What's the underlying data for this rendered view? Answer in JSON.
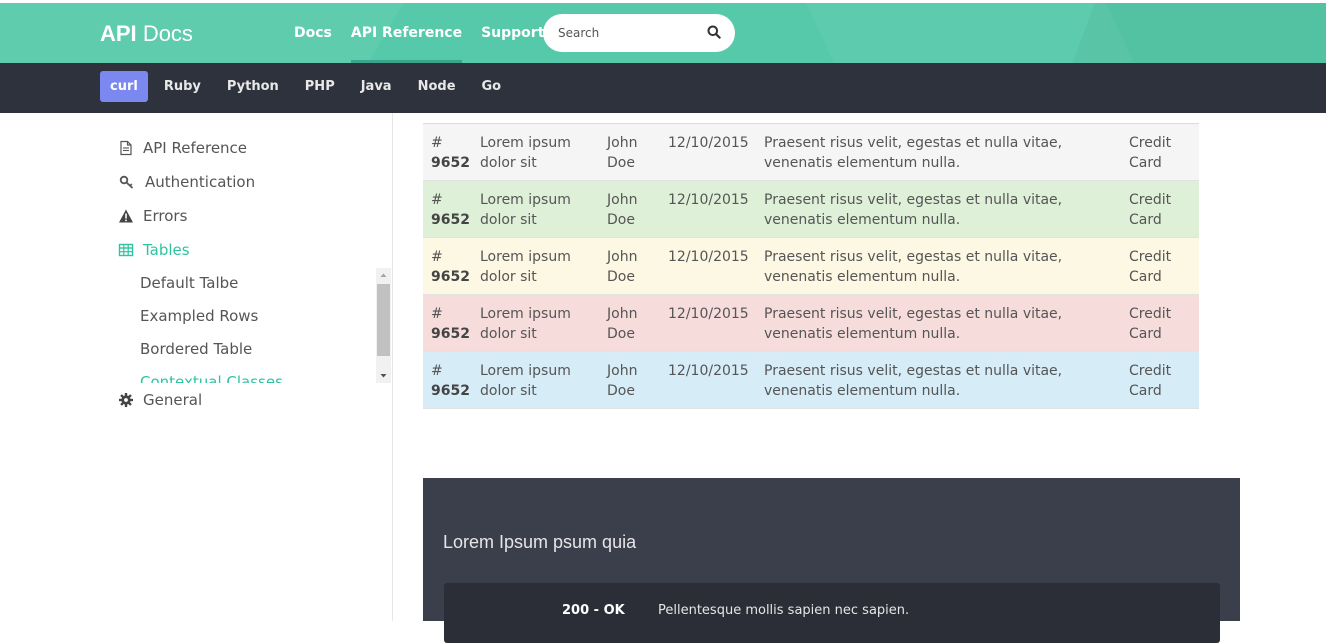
{
  "header": {
    "brand_bold": "API",
    "brand_light": "Docs",
    "nav": [
      {
        "label": "Docs"
      },
      {
        "label": "API Reference"
      },
      {
        "label": "Support"
      }
    ],
    "search_placeholder": "Search"
  },
  "languages": [
    "curl",
    "Ruby",
    "Python",
    "PHP",
    "Java",
    "Node",
    "Go"
  ],
  "sidebar": {
    "items": [
      {
        "label": "API Reference"
      },
      {
        "label": "Authentication"
      },
      {
        "label": "Errors"
      },
      {
        "label": "Tables"
      },
      {
        "label": "General"
      }
    ],
    "sub_items": [
      {
        "label": "Default Talbe"
      },
      {
        "label": "Exampled Rows"
      },
      {
        "label": "Bordered Table"
      },
      {
        "label": "Contextual Classes"
      }
    ]
  },
  "table": {
    "rows": [
      {
        "num_prefix": "#",
        "num": "9652",
        "title": "Lorem ipsum dolor sit",
        "name": "John Doe",
        "date": "12/10/2015",
        "desc": "Praesent risus velit, egestas et nulla vitae, venenatis elementum nulla.",
        "payment": "Credit Card"
      },
      {
        "num_prefix": "#",
        "num": "9652",
        "title": "Lorem ipsum dolor sit",
        "name": "John Doe",
        "date": "12/10/2015",
        "desc": "Praesent risus velit, egestas et nulla vitae, venenatis elementum nulla.",
        "payment": "Credit Card"
      },
      {
        "num_prefix": "#",
        "num": "9652",
        "title": "Lorem ipsum dolor sit",
        "name": "John Doe",
        "date": "12/10/2015",
        "desc": "Praesent risus velit, egestas et nulla vitae, venenatis elementum nulla.",
        "payment": "Credit Card"
      },
      {
        "num_prefix": "#",
        "num": "9652",
        "title": "Lorem ipsum dolor sit",
        "name": "John Doe",
        "date": "12/10/2015",
        "desc": "Praesent risus velit, egestas et nulla vitae, venenatis elementum nulla.",
        "payment": "Credit Card"
      },
      {
        "num_prefix": "#",
        "num": "9652",
        "title": "Lorem ipsum dolor sit",
        "name": "John Doe",
        "date": "12/10/2015",
        "desc": "Praesent risus velit, egestas et nulla vitae, venenatis elementum nulla.",
        "payment": "Credit Card"
      }
    ]
  },
  "panel": {
    "title": "Lorem Ipsum psum quia",
    "status": "200 - OK",
    "message": "Pellentesque mollis sapien nec sapien."
  },
  "colors": {
    "header_bg": "#55c9a9",
    "langbar_bg": "#2e323d",
    "active_lang": "#7b88f0",
    "accent": "#2ec4a0",
    "row_success": "#dff0d8",
    "row_warning": "#fcf8e3",
    "row_danger": "#f7dcdc",
    "row_info": "#d6ecf7",
    "panel_bg": "#3b3f4b"
  },
  "icons": [
    "file-icon",
    "key-icon",
    "warning-icon",
    "table-icon",
    "gear-icon",
    "search-icon"
  ]
}
